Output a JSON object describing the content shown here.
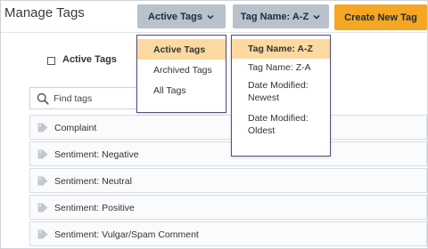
{
  "header": {
    "title": "Manage Tags",
    "filter_button_label": "Active Tags",
    "sort_button_label": "Tag Name: A-Z",
    "create_button_label": "Create New Tag"
  },
  "filter_menu": {
    "options": [
      "Active Tags",
      "Archived Tags",
      "All Tags"
    ],
    "selected": "Active Tags"
  },
  "sort_menu": {
    "options": [
      "Tag Name: A-Z",
      "Tag Name: Z-A",
      "Date Modified: Newest",
      "Date Modified: Oldest"
    ],
    "options_display": [
      [
        "Tag Name: A-Z"
      ],
      [
        "Tag Name: Z-A"
      ],
      [
        "Date Modified:",
        "Newest"
      ],
      [
        "Date Modified:",
        "Oldest"
      ]
    ],
    "selected": "Tag Name: A-Z"
  },
  "filter_checkbox": {
    "label": "Active Tags",
    "checked": false
  },
  "search": {
    "placeholder": "Find tags",
    "value": ""
  },
  "tags": [
    {
      "label": "Complaint"
    },
    {
      "label": "Sentiment: Negative"
    },
    {
      "label": "Sentiment: Neutral"
    },
    {
      "label": "Sentiment: Positive"
    },
    {
      "label": "Sentiment: Vulgar/Spam Comment"
    }
  ],
  "colors": {
    "dropdown_bg": "#b8c1cc",
    "create_bg": "#f5a623",
    "selected_option_bg": "#fcd9a0",
    "menu_border": "#5a4a78"
  },
  "icons": {
    "chevron": "chevron-down-icon",
    "search": "search-icon",
    "tag": "tag-icon"
  }
}
